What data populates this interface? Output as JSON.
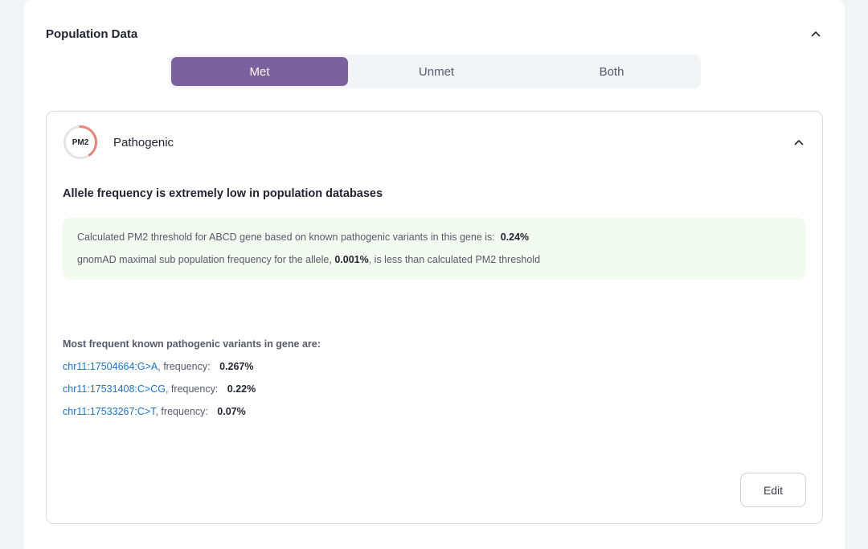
{
  "section": {
    "title": "Population Data",
    "collapse_icon": "chevron-up-icon"
  },
  "filter": {
    "options": [
      "Met",
      "Unmet",
      "Both"
    ],
    "selected": "Met",
    "accent_color": "#7b619d"
  },
  "criterion": {
    "code": "PM2",
    "classification": "Pathogenic",
    "ring_color": "#e8867a",
    "ring_progress": 0.4,
    "heading": "Allele frequency is extremely low in population databases",
    "threshold_text": "Calculated PM2 threshold for ABCD gene based on known pathogenic variants in this gene is:",
    "threshold_value": "0.24%",
    "gnomad_prefix": "gnomAD maximal sub population frequency for the allele,",
    "gnomad_value": "0.001%",
    "gnomad_suffix": ", is less than calculated PM2 threshold",
    "variants_title": "Most frequent known pathogenic variants in gene are:",
    "frequency_label": ", frequency:",
    "variants": [
      {
        "id": "chr11:17504664:G>A",
        "frequency": "0.267%"
      },
      {
        "id": "chr11:17531408:C>CG",
        "frequency": "0.22%"
      },
      {
        "id": "chr11:17533267:C>T",
        "frequency": "0.07%"
      }
    ],
    "edit_label": "Edit"
  }
}
